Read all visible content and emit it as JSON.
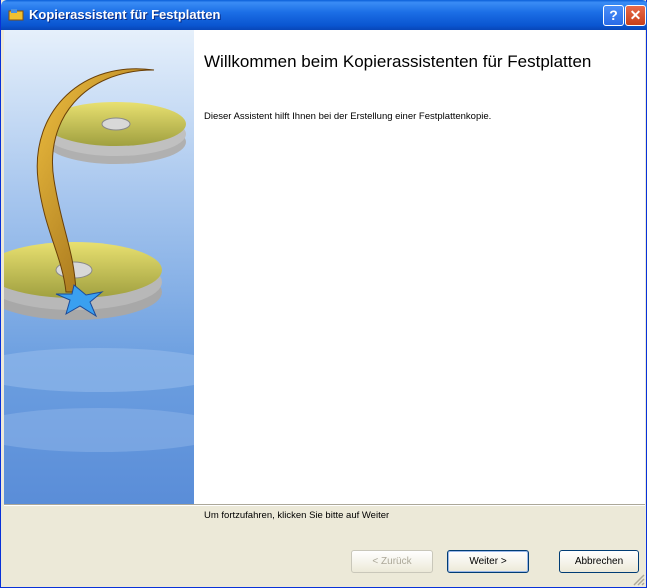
{
  "window": {
    "title": "Kopierassistent für Festplatten",
    "help_icon": "help-icon",
    "close_icon": "close-icon"
  },
  "sidebar": {
    "image": "disk-copy-illustration"
  },
  "main": {
    "heading": "Willkommen beim Kopierassistenten für Festplatten",
    "intro": "Dieser Assistent hilft Ihnen bei der Erstellung einer Festplattenkopie.",
    "continue_text": "Um fortzufahren, klicken Sie bitte auf Weiter"
  },
  "buttons": {
    "back": "< Zurück",
    "next": "Weiter >",
    "cancel": "Abbrechen"
  },
  "colors": {
    "titlebar": "#0a55d0",
    "face": "#ece9d8",
    "accent": "#003c74"
  }
}
